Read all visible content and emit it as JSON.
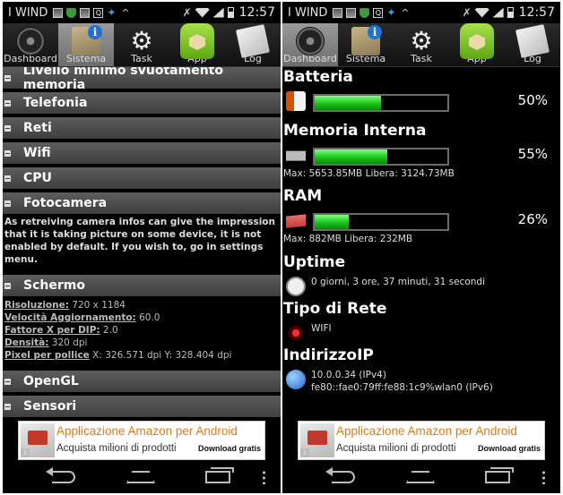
{
  "status_bar": {
    "carrier": "I WIND",
    "time": "12:57"
  },
  "tabs": [
    {
      "label": "Dashboard",
      "icon": "dashboard-gauge-icon"
    },
    {
      "label": "Sistema",
      "icon": "system-info-icon"
    },
    {
      "label": "Task",
      "icon": "gear-icon"
    },
    {
      "label": "App",
      "icon": "android-app-icon"
    },
    {
      "label": "Log",
      "icon": "log-paper-icon"
    }
  ],
  "left_screen": {
    "active_tab": "Sistema",
    "sections": [
      {
        "title": "Livello minimo svuotamento memoria"
      },
      {
        "title": "Telefonia"
      },
      {
        "title": "Reti"
      },
      {
        "title": "Wifi"
      },
      {
        "title": "CPU"
      },
      {
        "title": "Fotocamera"
      }
    ],
    "camera_note": "As retreiving camera infos can give the impression that it is taking picture on some device, it is not enabled by default. If you wish to, go in settings menu.",
    "screen_section": {
      "title": "Schermo",
      "items": [
        {
          "key": "Risoluzione:",
          "value": " 720 x 1184"
        },
        {
          "key": "Velocità Aggiornamento:",
          "value": " 60.0"
        },
        {
          "key": "Fattore X per DIP:",
          "value": " 2.0"
        },
        {
          "key": "Densità:",
          "value": " 320 dpi"
        },
        {
          "key": "Pixel per pollice",
          "value": " X: 326.571 dpi Y: 328.404 dpi"
        }
      ]
    },
    "more_sections": [
      {
        "title": "OpenGL"
      },
      {
        "title": "Sensori"
      }
    ]
  },
  "right_screen": {
    "active_tab": "Dashboard",
    "battery": {
      "title": "Batteria",
      "percent_label": "50%",
      "level": 0.5
    },
    "internal_memory": {
      "title": "Memoria Interna",
      "percent_label": "55%",
      "level": 0.55,
      "detail": "Max: 5653.85MB Libera: 3124.73MB"
    },
    "ram": {
      "title": "RAM",
      "percent_label": "26%",
      "level": 0.26,
      "detail": "Max: 882MB Libera: 232MB"
    },
    "uptime": {
      "title": "Uptime",
      "value": "0 giorni, 3 ore, 37 minuti, 31 secondi"
    },
    "network_type": {
      "title": "Tipo di Rete",
      "value": "WIFI"
    },
    "ip_address": {
      "title": "IndirizzoIP",
      "ipv4": "10.0.0.34 (IPv4)",
      "ipv6": "fe80::fae0:79ff:fe88:1c9%wlan0 (IPv6)"
    }
  },
  "ad": {
    "title": "Applicazione Amazon per Android",
    "subtitle": "Acquista milioni di prodotti",
    "cta": "Download gratis"
  },
  "colors": {
    "accent_green": "#19c419",
    "ad_orange": "#e47911",
    "section_gray": "#4a4a4a"
  }
}
